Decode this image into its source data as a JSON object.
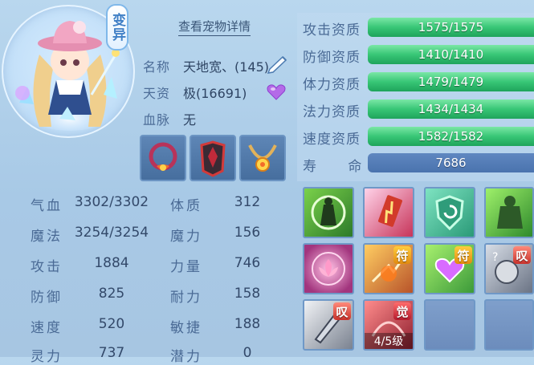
{
  "pet": {
    "mutation_badge": "变异",
    "detail_link": "查看宠物详情",
    "name_label": "名称",
    "name_value": "天地宽、(145)",
    "aptitude_label": "天资",
    "aptitude_value": "极(16691)",
    "bloodline_label": "血脉",
    "bloodline_value": "无"
  },
  "stats_left": [
    {
      "key": "气血",
      "value": "3302/3302"
    },
    {
      "key": "魔法",
      "value": "3254/3254"
    },
    {
      "key": "攻击",
      "value": "1884"
    },
    {
      "key": "防御",
      "value": "825"
    },
    {
      "key": "速度",
      "value": "520"
    },
    {
      "key": "灵力",
      "value": "737"
    }
  ],
  "stats_right": [
    {
      "key": "体质",
      "value": "312"
    },
    {
      "key": "魔力",
      "value": "156"
    },
    {
      "key": "力量",
      "value": "746"
    },
    {
      "key": "耐力",
      "value": "158"
    },
    {
      "key": "敏捷",
      "value": "188"
    },
    {
      "key": "潜力",
      "value": "0"
    }
  ],
  "qualifications": [
    {
      "key": "攻击资质",
      "value": "1575/1575",
      "fill": 1.0
    },
    {
      "key": "防御资质",
      "value": "1410/1410",
      "fill": 1.0
    },
    {
      "key": "体力资质",
      "value": "1479/1479",
      "fill": 1.0
    },
    {
      "key": "法力资质",
      "value": "1434/1434",
      "fill": 1.0
    },
    {
      "key": "速度资质",
      "value": "1582/1582",
      "fill": 1.0
    }
  ],
  "lifespan": {
    "key": "寿      命",
    "value": "7686"
  },
  "skills": {
    "tag_fu": "符",
    "tag_tan": "叹",
    "tag_jue": "觉",
    "awaken_level": "4/5级"
  },
  "colors": {
    "bar_green": "#38c676",
    "bar_dark": "#2d4d73",
    "life_blue": "#4a73ae",
    "background": "#b9d7ee"
  }
}
